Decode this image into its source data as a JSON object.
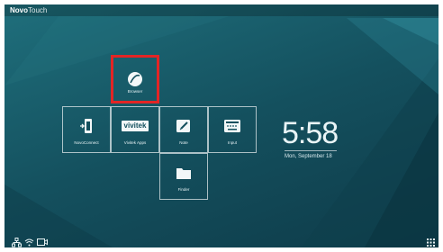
{
  "topbar": {
    "brand_bold": "Novo",
    "brand_light": "Touch"
  },
  "apps": [
    {
      "label": "Browser",
      "icon": "globe-icon"
    },
    {
      "label": "NovoConnect",
      "icon": "novoconnect-icon"
    },
    {
      "label": "Vivitek Apps",
      "icon": "vivitek-logo",
      "logo_text": "vivitek"
    },
    {
      "label": "Note",
      "icon": "note-pen-icon"
    },
    {
      "label": "Input",
      "icon": "input-keyboard-icon"
    },
    {
      "label": "Finder",
      "icon": "folder-icon"
    }
  ],
  "clock": {
    "time": "5:58",
    "date": "Mon, September 18"
  },
  "colors": {
    "highlight": "#e32525",
    "background": "#14505e"
  },
  "system_icons": [
    "network-icon",
    "wifi-icon",
    "screen-share-icon",
    "app-grid-icon"
  ]
}
